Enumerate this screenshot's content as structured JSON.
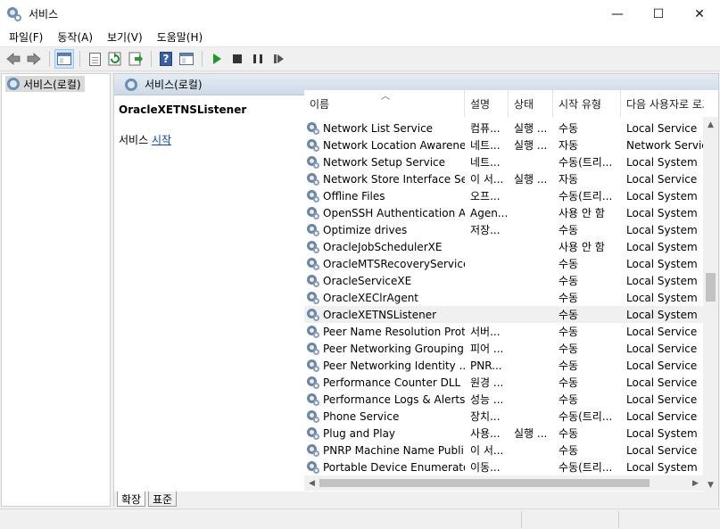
{
  "window": {
    "title": "서비스",
    "controls": {
      "minimize": "—",
      "maximize": "☐",
      "close": "✕"
    }
  },
  "menu": [
    "파일(F)",
    "동작(A)",
    "보기(V)",
    "도움말(H)"
  ],
  "toolbar": {
    "icons": [
      "back-icon",
      "forward-icon",
      "show-hide-console-tree-icon",
      "properties-icon",
      "refresh-icon",
      "export-list-icon",
      "help-icon",
      "show-hide-action-pane-icon",
      "start-service-icon",
      "stop-service-icon",
      "pause-service-icon",
      "restart-service-icon"
    ]
  },
  "tree": {
    "root_label": "서비스(로컬)"
  },
  "pane": {
    "header": "서비스(로컬)",
    "selected_service": "OracleXETNSListener",
    "action_prefix": "서비스",
    "action_link": "시작"
  },
  "columns": [
    "이름",
    "설명",
    "상태",
    "시작 유형",
    "다음 사용자로 로그온"
  ],
  "services": [
    {
      "name": "Network List Service",
      "desc": "컴퓨...",
      "status": "실행 ...",
      "start": "수동",
      "logon": "Local Service"
    },
    {
      "name": "Network Location Awareness",
      "desc": "네트...",
      "status": "실행 ...",
      "start": "자동",
      "logon": "Network Service"
    },
    {
      "name": "Network Setup Service",
      "desc": "네트...",
      "status": "",
      "start": "수동(트리...",
      "logon": "Local System"
    },
    {
      "name": "Network Store Interface Se...",
      "desc": "이 서...",
      "status": "실행 ...",
      "start": "자동",
      "logon": "Local Service"
    },
    {
      "name": "Offline Files",
      "desc": "오프...",
      "status": "",
      "start": "수동(트리...",
      "logon": "Local System"
    },
    {
      "name": "OpenSSH Authentication A...",
      "desc": "Agen...",
      "status": "",
      "start": "사용 안 함",
      "logon": "Local System"
    },
    {
      "name": "Optimize drives",
      "desc": "저장...",
      "status": "",
      "start": "수동",
      "logon": "Local System"
    },
    {
      "name": "OracleJobSchedulerXE",
      "desc": "",
      "status": "",
      "start": "사용 안 함",
      "logon": "Local System"
    },
    {
      "name": "OracleMTSRecoveryService",
      "desc": "",
      "status": "",
      "start": "수동",
      "logon": "Local System"
    },
    {
      "name": "OracleServiceXE",
      "desc": "",
      "status": "",
      "start": "수동",
      "logon": "Local System"
    },
    {
      "name": "OracleXEClrAgent",
      "desc": "",
      "status": "",
      "start": "수동",
      "logon": "Local System"
    },
    {
      "name": "OracleXETNSListener",
      "desc": "",
      "status": "",
      "start": "수동",
      "logon": "Local System",
      "selected": true
    },
    {
      "name": "Peer Name Resolution Prot...",
      "desc": "서버...",
      "status": "",
      "start": "수동",
      "logon": "Local Service"
    },
    {
      "name": "Peer Networking Grouping",
      "desc": "피어 ...",
      "status": "",
      "start": "수동",
      "logon": "Local Service"
    },
    {
      "name": "Peer Networking Identity ...",
      "desc": "PNR...",
      "status": "",
      "start": "수동",
      "logon": "Local Service"
    },
    {
      "name": "Performance Counter DLL ...",
      "desc": "원경 ...",
      "status": "",
      "start": "수동",
      "logon": "Local Service"
    },
    {
      "name": "Performance Logs & Alerts",
      "desc": "성능 ...",
      "status": "",
      "start": "수동",
      "logon": "Local Service"
    },
    {
      "name": "Phone Service",
      "desc": "장치...",
      "status": "",
      "start": "수동(트리...",
      "logon": "Local Service"
    },
    {
      "name": "Plug and Play",
      "desc": "사용...",
      "status": "실행 ...",
      "start": "수동",
      "logon": "Local System"
    },
    {
      "name": "PNRP Machine Name Publi...",
      "desc": "이 서...",
      "status": "",
      "start": "수동",
      "logon": "Local Service"
    },
    {
      "name": "Portable Device Enumerato...",
      "desc": "이동...",
      "status": "",
      "start": "수동(트리...",
      "logon": "Local System"
    }
  ],
  "tabs": [
    "확장",
    "표준"
  ]
}
